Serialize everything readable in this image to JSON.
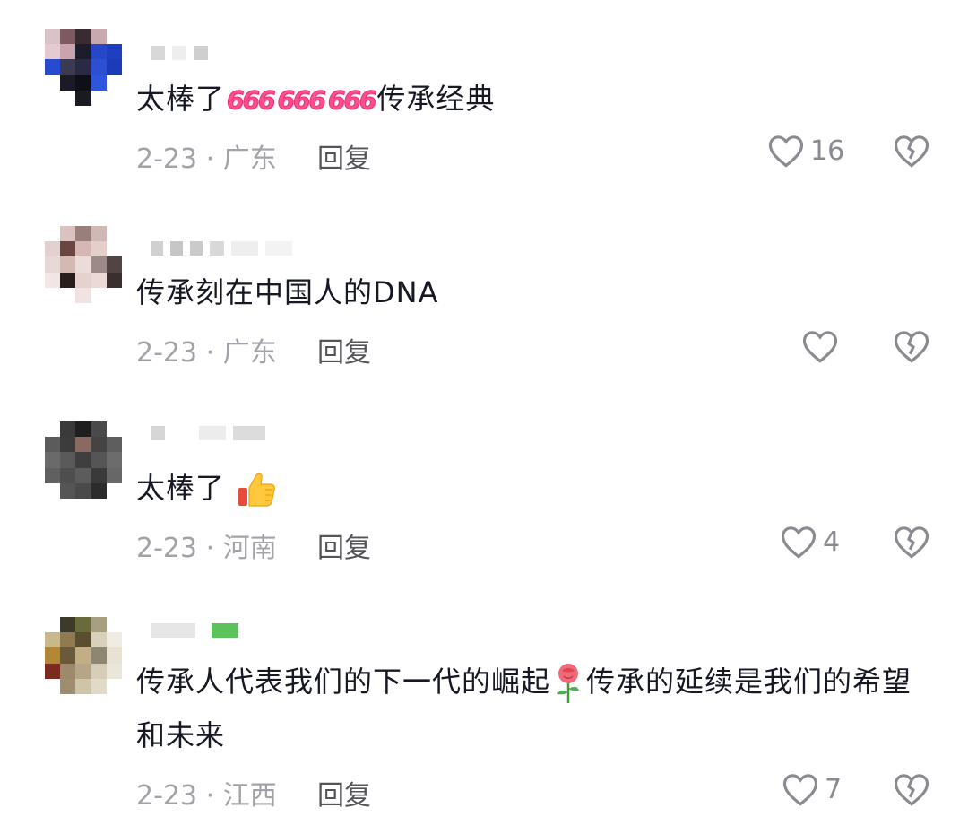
{
  "comments": [
    {
      "text_before": "太棒了",
      "emoji_text": "666",
      "text_after": "传承经典",
      "date_location": "2-23 · 广东",
      "reply_label": "回复",
      "like_count": "16"
    },
    {
      "text": "传承刻在中国人的DNA",
      "date_location": "2-23 · 广东",
      "reply_label": "回复",
      "like_count": ""
    },
    {
      "text": "太棒了",
      "date_location": "2-23 · 河南",
      "reply_label": "回复",
      "like_count": "4"
    },
    {
      "text_before": "传承人代表我们的下一代的崛起",
      "text_after": "传承的延续是我们的希望和未来",
      "date_location": "2-23 · 江西",
      "reply_label": "回复",
      "like_count": "7"
    }
  ],
  "icons": {
    "like": "heart-outline-icon",
    "dislike": "broken-heart-icon",
    "thumbs_up": "thumbs-up-emoji",
    "rose": "rose-emoji",
    "emoji_666": "666-emoji"
  },
  "colors": {
    "text": "#161823",
    "meta": "#a2a3a8",
    "reply": "#545559",
    "icon": "#8a8b91",
    "emoji_666": "#ff4f8b"
  }
}
